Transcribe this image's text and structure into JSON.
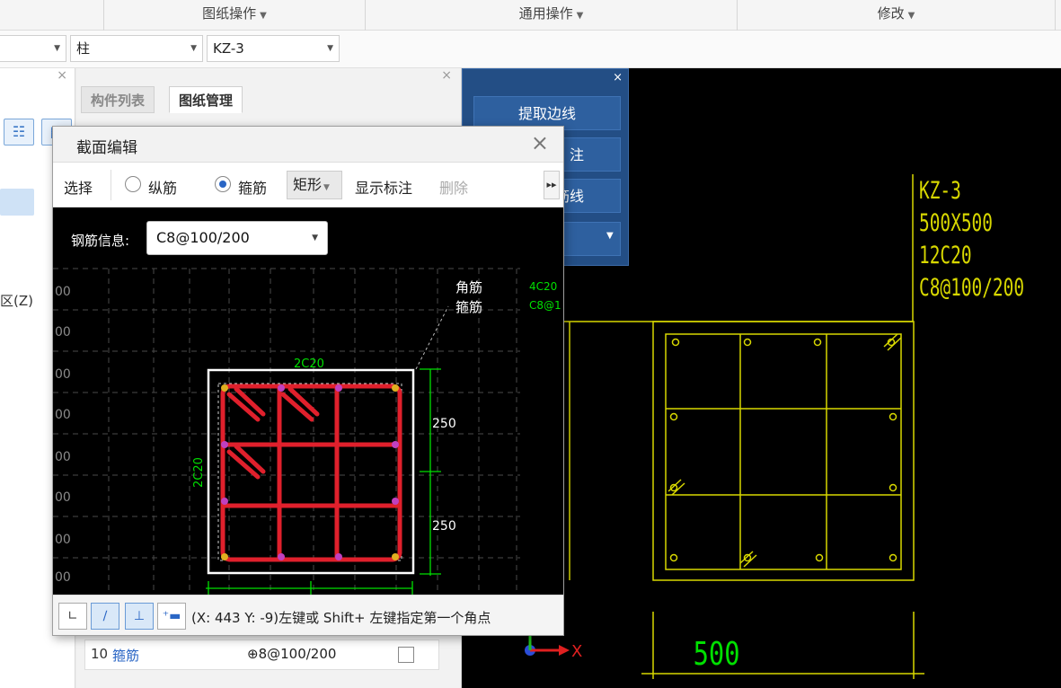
{
  "menu": {
    "groups": [
      {
        "label": "图纸操作"
      },
      {
        "label": "通用操作"
      },
      {
        "label": "修改"
      }
    ]
  },
  "selectors": {
    "floor": "",
    "category": "柱",
    "component": "KZ-3"
  },
  "left_pane": {
    "partial_label": "区(Z)"
  },
  "mid_pane": {
    "tabs": [
      {
        "label": "构件列表",
        "active": false
      },
      {
        "label": "图纸管理",
        "active": true
      }
    ],
    "row": {
      "index": "10",
      "name": "箍筋",
      "value": "⊕8@100/200"
    }
  },
  "tool_panel": {
    "buttons": [
      {
        "label": "提取边线"
      },
      {
        "label": "注"
      },
      {
        "label": "筋线"
      },
      {
        "label": "刂"
      }
    ]
  },
  "dialog": {
    "title": "截面编辑",
    "toolbar": {
      "select": "选择",
      "radio_long": "纵筋",
      "radio_stirrup": "箍筋",
      "radio_selected": "stirrup",
      "shape": "矩形",
      "show_dim": "显示标注",
      "delete": "删除"
    },
    "info_label": "钢筋信息:",
    "info_value": "C8@100/200",
    "canvas": {
      "grid_labels": [
        "00",
        "00",
        "00",
        "00",
        "00",
        "00",
        "00",
        "00"
      ],
      "top_rebar": "2C20",
      "side_rebar": "2C20",
      "corner_label": "角筋",
      "stirrup_label": "箍筋",
      "side_note_1": "4C20",
      "side_note_2": "C8@1",
      "dim_1": "250",
      "dim_2": "250"
    },
    "status": "(X: 443 Y: -9)左键或 Shift+ 左键指定第一个角点"
  },
  "cad_view": {
    "label_lines": [
      "KZ-3",
      "500X500",
      "12C20",
      "C8@100/200"
    ],
    "bottom_dim": "500"
  },
  "colors": {
    "cad_yellow": "#d8d800",
    "cad_green": "#00e000",
    "rebar_red": "#e0202c",
    "panel_blue": "#234e85"
  }
}
